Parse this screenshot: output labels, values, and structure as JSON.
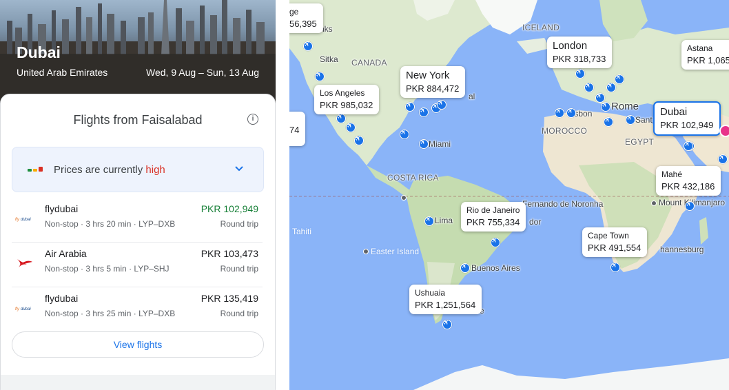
{
  "destination": {
    "city": "Dubai",
    "country": "United Arab Emirates",
    "dates": "Wed, 9 Aug – Sun, 13 Aug"
  },
  "flights_panel": {
    "title": "Flights from Faisalabad",
    "price_insight_prefix": "Prices are currently",
    "price_insight_level": "high",
    "view_button": "View flights",
    "colors": {
      "cheap": "#188038",
      "high": "#d93025",
      "accent": "#1a73e8"
    },
    "flights": [
      {
        "airline": "flydubai",
        "logo": "flydubai-logo",
        "stops": "Non-stop",
        "duration": "3 hrs 20 min",
        "route": "LYP–DXB",
        "price": "PKR 102,949",
        "trip": "Round trip",
        "cheapest": true
      },
      {
        "airline": "Air Arabia",
        "logo": "air-arabia-logo",
        "stops": "Non-stop",
        "duration": "3 hrs 5 min",
        "route": "LYP–SHJ",
        "price": "PKR 103,473",
        "trip": "Round trip",
        "cheapest": false
      },
      {
        "airline": "flydubai",
        "logo": "flydubai-logo",
        "stops": "Non-stop",
        "duration": "3 hrs 25 min",
        "route": "LYP–DXB",
        "price": "PKR 135,419",
        "trip": "Round trip",
        "cheapest": false
      }
    ]
  },
  "map": {
    "price_bubbles": [
      {
        "city": "ge",
        "price": "56,395"
      },
      {
        "city": "Los Angeles",
        "price": "PKR 985,032"
      },
      {
        "city": "New York",
        "price": "PKR 884,472"
      },
      {
        "city": "London",
        "price": "PKR 318,733"
      },
      {
        "city": "Astana",
        "price": "PKR 1,065"
      },
      {
        "city": "Dubai",
        "price": "PKR 102,949",
        "selected": true
      },
      {
        "city": "Mahé",
        "price": "PKR 432,186"
      },
      {
        "city": "Rio de Janeiro",
        "price": "PKR 755,334"
      },
      {
        "city": "Cape Town",
        "price": "PKR 491,554"
      },
      {
        "city": "Ushuaia",
        "price": "PKR 1,251,564"
      },
      {
        "city": "",
        "price": "74"
      }
    ],
    "labels": {
      "iceland": "ICELAND",
      "canada": "CANADA",
      "morocco": "MOROCCO",
      "egypt": "EGYPT",
      "costa_rica": "COSTA RICA",
      "sitka": "Sitka",
      "nks": "nks",
      "al": "al",
      "rome": "Rome",
      "lisbon": "Lisbon",
      "sant": "Sant",
      "miami": "Miami",
      "lima": "Lima",
      "dor": "dor",
      "fernando": "Fernando de Noronha",
      "mount_kilimanjaro": "Mount Kilimanjaro",
      "buenos_aires": "Buenos Aires",
      "easter_island": "Easter Island",
      "tahiti": "Tahiti",
      "johannesburg": "hannesburg",
      "e": "e"
    }
  }
}
